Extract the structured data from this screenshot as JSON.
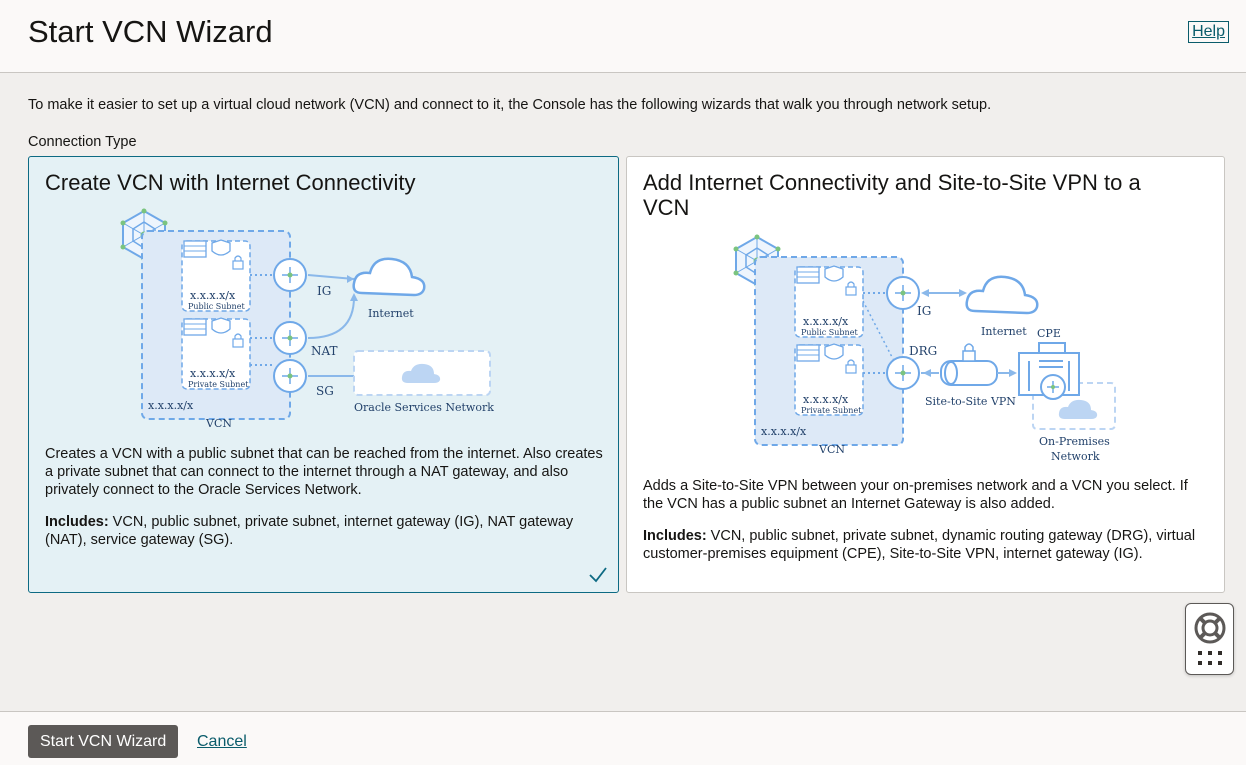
{
  "header": {
    "title": "Start VCN Wizard",
    "help_label": "Help"
  },
  "main": {
    "intro": "To make it easier to set up a virtual cloud network (VCN) and connect to it, the Console has the following wizards that walk you through network setup.",
    "connection_type_label": "Connection Type",
    "cards": [
      {
        "title": "Create VCN with Internet Connectivity",
        "selected": true,
        "description": "Creates a VCN with a public subnet that can be reached from the internet. Also creates a private subnet that can connect to the internet through a NAT gateway, and also privately connect to the Oracle Services Network.",
        "includes_label": "Includes:",
        "includes_text": " VCN, public subnet, private subnet, internet gateway (IG), NAT gateway (NAT), service gateway (SG).",
        "diagram": {
          "public_cidr": "x.x.x.x/x",
          "public_label": "Public Subnet",
          "private_cidr": "x.x.x.x/x",
          "private_label": "Private Subnet",
          "vcn_cidr": "x.x.x.x/x",
          "vcn_label": "VCN",
          "ig_label": "IG",
          "nat_label": "NAT",
          "sg_label": "SG",
          "internet_label": "Internet",
          "osn_label": "Oracle Services Network"
        }
      },
      {
        "title": "Add Internet Connectivity and Site-to-Site VPN to a VCN",
        "selected": false,
        "description": "Adds a Site-to-Site VPN between your on-premises network and a VCN you select. If the VCN has a public subnet an Internet Gateway is also added.",
        "includes_label": "Includes:",
        "includes_text": " VCN, public subnet, private subnet, dynamic routing gateway (DRG), virtual customer-premises equipment (CPE), Site-to-Site VPN, internet gateway (IG).",
        "diagram": {
          "public_cidr": "x.x.x.x/x",
          "public_label": "Public Subnet",
          "private_cidr": "x.x.x.x/x",
          "private_label": "Private Subnet",
          "vcn_cidr": "x.x.x.x/x",
          "vcn_label": "VCN",
          "ig_label": "IG",
          "drg_label": "DRG",
          "internet_label": "Internet",
          "vpn_label": "Site-to-Site VPN",
          "cpe_label": "CPE",
          "onprem_label_1": "On-Premises",
          "onprem_label_2": "Network"
        }
      }
    ]
  },
  "footer": {
    "start_label": "Start VCN Wizard",
    "cancel_label": "Cancel"
  },
  "icons": {
    "selected_check": "checkmark-icon",
    "help_widget_top": "lifebuoy-icon",
    "help_widget_bottom": "grid-icon"
  },
  "colors": {
    "accent": "#0a5c6b",
    "selected_card_bg": "#e4f1f5",
    "selected_card_border": "#0d6a83",
    "primary_button": "#5c5957",
    "diagram_blue": "#6fa8e8"
  }
}
